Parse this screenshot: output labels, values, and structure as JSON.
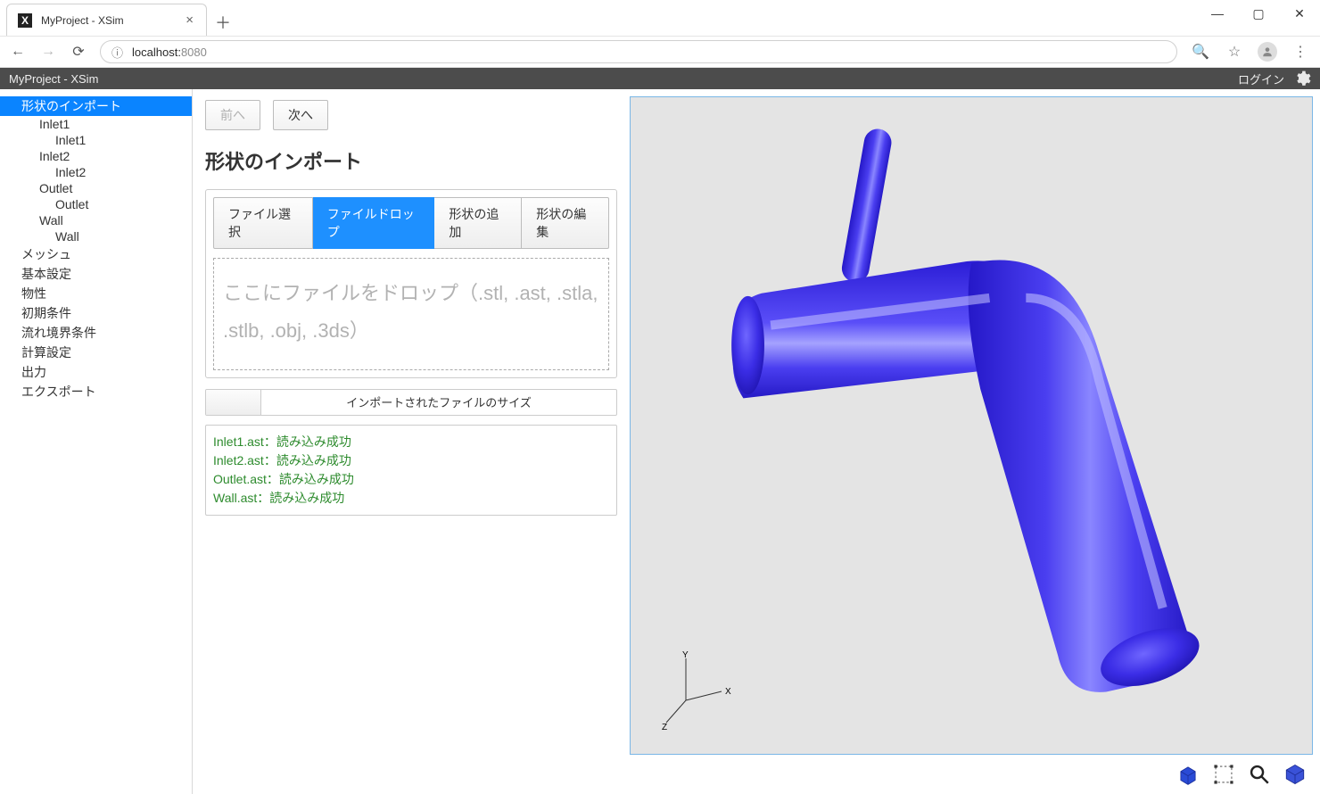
{
  "browser": {
    "tab_title": "MyProject - XSim",
    "url_host": "localhost:",
    "url_port": "8080"
  },
  "appbar": {
    "title": "MyProject - XSim",
    "login": "ログイン"
  },
  "tree": [
    {
      "label": "形状のインポート",
      "depth": 0,
      "selected": true
    },
    {
      "label": "Inlet1",
      "depth": 1
    },
    {
      "label": "Inlet1",
      "depth": 2
    },
    {
      "label": "Inlet2",
      "depth": 1
    },
    {
      "label": "Inlet2",
      "depth": 2
    },
    {
      "label": "Outlet",
      "depth": 1
    },
    {
      "label": "Outlet",
      "depth": 2
    },
    {
      "label": "Wall",
      "depth": 1
    },
    {
      "label": "Wall",
      "depth": 2
    },
    {
      "label": "メッシュ",
      "depth": 0
    },
    {
      "label": "基本設定",
      "depth": 0
    },
    {
      "label": "物性",
      "depth": 0
    },
    {
      "label": "初期条件",
      "depth": 0
    },
    {
      "label": "流れ境界条件",
      "depth": 0
    },
    {
      "label": "計算設定",
      "depth": 0
    },
    {
      "label": "出力",
      "depth": 0
    },
    {
      "label": "エクスポート",
      "depth": 0
    }
  ],
  "nav": {
    "prev": "前へ",
    "next": "次へ"
  },
  "page_title": "形状のインポート",
  "tabs": [
    {
      "label": "ファイル選択",
      "active": false
    },
    {
      "label": "ファイルドロップ",
      "active": true
    },
    {
      "label": "形状の追加",
      "active": false
    },
    {
      "label": "形状の編集",
      "active": false
    }
  ],
  "dropzone": "ここにファイルをドロップ（.stl, .ast, .stla, .stlb, .obj, .3ds）",
  "size_label": "インポートされたファイルのサイズ",
  "log": [
    "Inlet1.ast：読み込み成功",
    "Inlet2.ast：読み込み成功",
    "Outlet.ast：読み込み成功",
    "Wall.ast：読み込み成功"
  ],
  "axis": {
    "x": "X",
    "y": "Y",
    "z": "Z"
  }
}
